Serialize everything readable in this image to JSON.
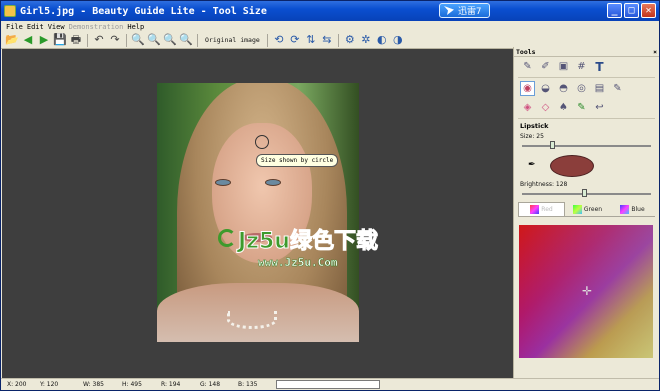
{
  "window": {
    "title": "Girl5.jpg - Beauty Guide Lite - Tool Size",
    "xunlei_label": "迅雷7",
    "controls": {
      "minimize": "_",
      "maximize": "□",
      "close": "✕"
    }
  },
  "menu": {
    "items": [
      {
        "label": "File",
        "disabled": false
      },
      {
        "label": "Edit",
        "disabled": false
      },
      {
        "label": "View",
        "disabled": false
      },
      {
        "label": "Demonstration",
        "disabled": true
      },
      {
        "label": "Help",
        "disabled": false
      }
    ]
  },
  "toolbar": {
    "original_image_label": "Original image",
    "icons": {
      "open": "📂",
      "back": "◀",
      "forward": "▶",
      "save": "💾",
      "print": "🖶",
      "undo": "↶",
      "redo": "↷",
      "zoom1": "🔍",
      "zoom2": "🔍",
      "zoom3": "🔍",
      "zoom4": "🔍",
      "rotate_left": "⟲",
      "rotate_right": "⟳",
      "flip_v": "⇅",
      "flip_h": "⇆",
      "settings": "⚙",
      "gear": "✲",
      "contrast": "◐",
      "circle": "◑"
    }
  },
  "canvas": {
    "tooltip": "Size shown by circle",
    "watermark_main": "Jz5u绿色下载",
    "watermark_url": "www.Jz5u.Com"
  },
  "tools_panel": {
    "title": "Tools",
    "close": "×",
    "row1": [
      "✎",
      "✐",
      "▣",
      "#",
      "T"
    ],
    "row2": [
      "◉",
      "◒",
      "◓",
      "◎",
      "▤",
      "✎"
    ],
    "row3": [
      "◈",
      "◇",
      "♠",
      "✎",
      "↩"
    ],
    "section": "Lipstick",
    "size_label": "Size: 25",
    "size_value": 25,
    "brightness_label": "Brightness: 128",
    "brightness_value": 128,
    "dropper": "✒",
    "swatch_color": "#8b3e3b",
    "tabs": [
      {
        "label": "Red",
        "active": true
      },
      {
        "label": "Green",
        "active": false
      },
      {
        "label": "Blue",
        "active": false
      }
    ],
    "crosshair": "✛"
  },
  "status": {
    "x": "X: 200",
    "y": "Y: 120",
    "w": "W: 385",
    "h": "H: 495",
    "r": "R: 194",
    "g": "G: 148",
    "b": "B: 135",
    "progress_fraction": 0
  },
  "colors": {
    "titlebar": "#0a4fd0",
    "canvas_bg": "#3e3e3e",
    "panel_bg": "#ece9d8"
  }
}
